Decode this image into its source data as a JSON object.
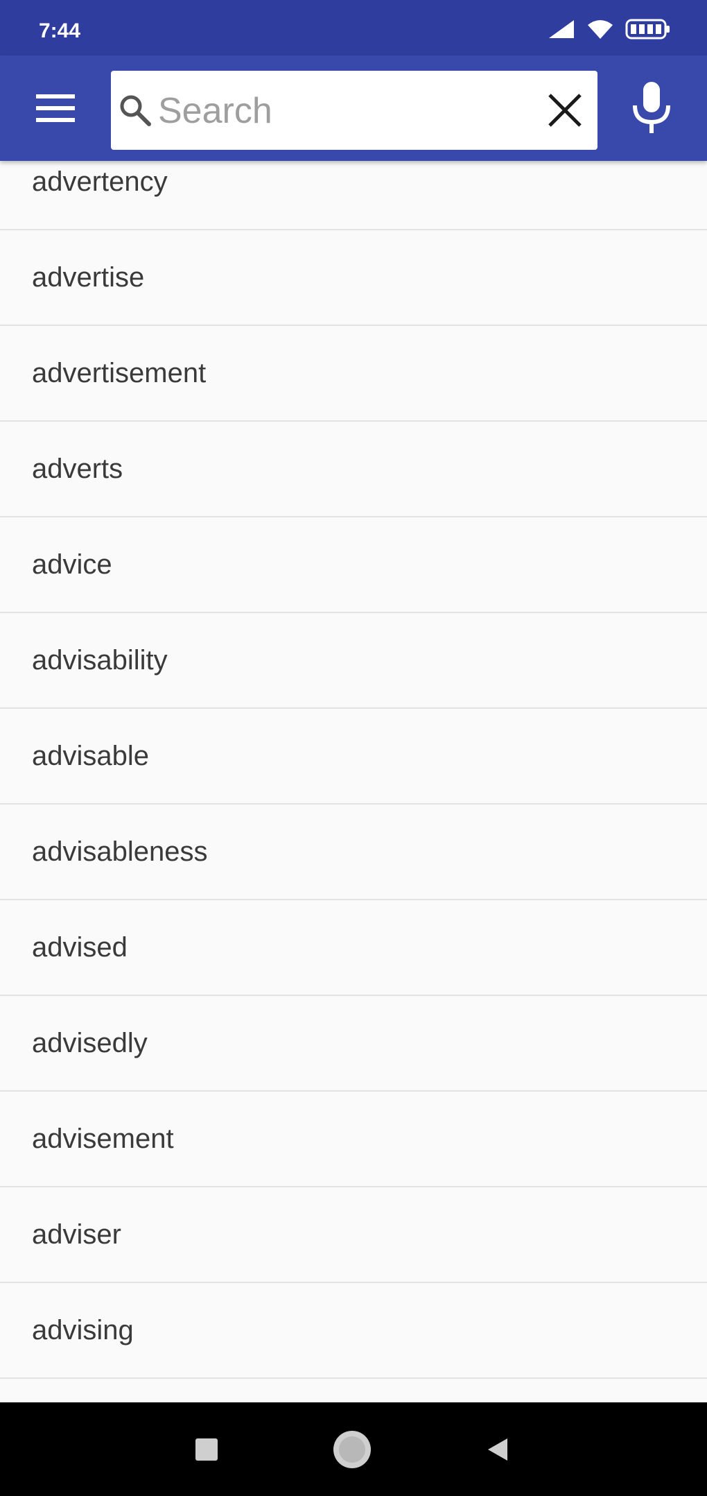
{
  "status_bar": {
    "time": "7:44",
    "icons": [
      "signal-icon",
      "wifi-icon",
      "battery-icon"
    ]
  },
  "app_bar": {
    "color": "#3949ab",
    "status_color": "#2f3d9e",
    "search": {
      "placeholder": "Search",
      "value": ""
    }
  },
  "word_list": {
    "items": [
      "advertency",
      "advertise",
      "advertisement",
      "adverts",
      "advice",
      "advisability",
      "advisable",
      "advisableness",
      "advised",
      "advisedly",
      "advisement",
      "adviser",
      "advising"
    ]
  },
  "nav_bar": {
    "buttons": [
      "recents-button",
      "home-button",
      "back-button"
    ]
  }
}
